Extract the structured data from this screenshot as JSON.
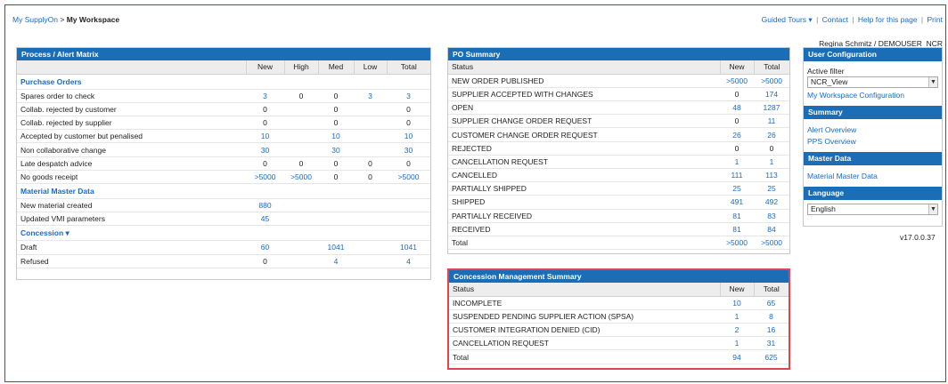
{
  "breadcrumb": {
    "root": "My SupplyOn",
    "sep": " > ",
    "current": "My Workspace"
  },
  "toplinks": {
    "guided": "Guided Tours",
    "caret": "▾",
    "contact": "Contact",
    "help": "Help for this page",
    "print": "Print",
    "sep": "|"
  },
  "user": "Regina Schmitz / DEMOUSER_NCR",
  "matrix": {
    "title": "Process / Alert Matrix",
    "columns": [
      "New",
      "High",
      "Med",
      "Low",
      "Total"
    ],
    "sections": [
      {
        "title": "Purchase Orders",
        "rows": [
          {
            "label": "Spares order to check",
            "cells": [
              "3",
              "0",
              "0",
              "3",
              "3"
            ]
          },
          {
            "label": "Collab. rejected by customer",
            "cells": [
              "0",
              "",
              "0",
              "",
              "0"
            ]
          },
          {
            "label": "Collab. rejected by supplier",
            "cells": [
              "0",
              "",
              "0",
              "",
              "0"
            ]
          },
          {
            "label": "Accepted by customer but penalised",
            "cells": [
              "10",
              "",
              "10",
              "",
              "10"
            ]
          },
          {
            "label": "Non collaborative change",
            "cells": [
              "30",
              "",
              "30",
              "",
              "30"
            ]
          },
          {
            "label": "Late despatch advice",
            "cells": [
              "0",
              "0",
              "0",
              "0",
              "0"
            ]
          },
          {
            "label": "No goods receipt",
            "cells": [
              ">5000",
              ">5000",
              "0",
              "0",
              ">5000"
            ]
          }
        ]
      },
      {
        "title": "Material Master Data",
        "rows": [
          {
            "label": "New material created",
            "cells": [
              "880",
              "",
              "",
              "",
              ""
            ]
          },
          {
            "label": "Updated VMI parameters",
            "cells": [
              "45",
              "",
              "",
              "",
              ""
            ]
          }
        ]
      },
      {
        "title": "Concession ▾",
        "rows": [
          {
            "label": "Draft",
            "cells": [
              "60",
              "",
              "1041",
              "",
              "1041"
            ]
          },
          {
            "label": "Refused",
            "cells": [
              "0",
              "",
              "4",
              "",
              "4"
            ]
          }
        ]
      }
    ]
  },
  "po": {
    "title": "PO Summary",
    "columns": [
      "Status",
      "New",
      "Total"
    ],
    "rows": [
      {
        "status": "NEW ORDER PUBLISHED",
        "new": ">5000",
        "total": ">5000"
      },
      {
        "status": "SUPPLIER ACCEPTED WITH CHANGES",
        "new": "0",
        "total": "174"
      },
      {
        "status": "OPEN",
        "new": "48",
        "total": "1287"
      },
      {
        "status": "SUPPLIER CHANGE ORDER REQUEST",
        "new": "0",
        "total": "11"
      },
      {
        "status": "CUSTOMER CHANGE ORDER REQUEST",
        "new": "26",
        "total": "26"
      },
      {
        "status": "REJECTED",
        "new": "0",
        "total": "0"
      },
      {
        "status": "CANCELLATION REQUEST",
        "new": "1",
        "total": "1"
      },
      {
        "status": "CANCELLED",
        "new": "111",
        "total": "113"
      },
      {
        "status": "PARTIALLY SHIPPED",
        "new": "25",
        "total": "25"
      },
      {
        "status": "SHIPPED",
        "new": "491",
        "total": "492"
      },
      {
        "status": "PARTIALLY RECEIVED",
        "new": "81",
        "total": "83"
      },
      {
        "status": "RECEIVED",
        "new": "81",
        "total": "84"
      },
      {
        "status": "Total",
        "new": ">5000",
        "total": ">5000"
      }
    ]
  },
  "concession": {
    "title": "Concession Management Summary",
    "columns": [
      "Status",
      "New",
      "Total"
    ],
    "rows": [
      {
        "status": "INCOMPLETE",
        "new": "10",
        "total": "65"
      },
      {
        "status": "SUSPENDED PENDING SUPPLIER ACTION (SPSA)",
        "new": "1",
        "total": "8"
      },
      {
        "status": "CUSTOMER INTEGRATION DENIED (CID)",
        "new": "2",
        "total": "16"
      },
      {
        "status": "CANCELLATION REQUEST",
        "new": "1",
        "total": "31"
      },
      {
        "status": "Total",
        "new": "94",
        "total": "625"
      }
    ]
  },
  "sidebar": {
    "user_config_title": "User Configuration",
    "active_filter_label": "Active filter",
    "active_filter_value": "NCR_View",
    "workspace_config_link": "My Workspace Configuration",
    "summary_title": "Summary",
    "alert_overview": "Alert Overview",
    "pps_overview": "PPS Overview",
    "master_data_title": "Master Data",
    "material_master_data": "Material Master Data",
    "language_title": "Language",
    "language_value": "English"
  },
  "version": "v17.0.0.37",
  "colors": {
    "header_blue": "#1b6db5",
    "link_blue": "#1a6bc4",
    "highlight_red": "#e0454a"
  }
}
